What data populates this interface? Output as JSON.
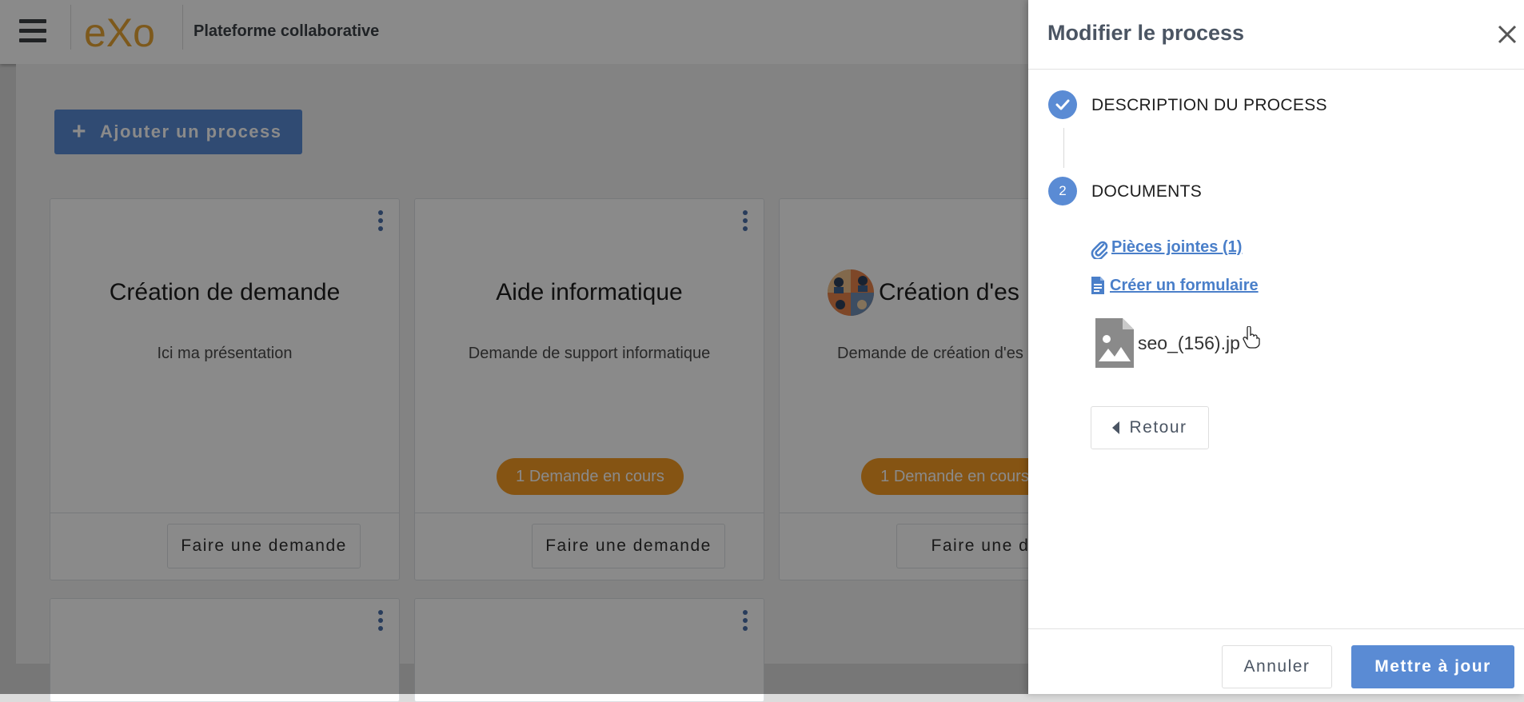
{
  "header": {
    "brand": "eXo",
    "platform_name": "Plateforme collaborative"
  },
  "toolbar": {
    "add_process_label": "Ajouter un process"
  },
  "cards": [
    {
      "title": "Création de demande",
      "description": "Ici ma présentation",
      "badge": "",
      "action": "Faire une demande"
    },
    {
      "title": "Aide informatique",
      "description": "Demande de support informatique",
      "badge": "1 Demande en cours",
      "action": "Faire une demande"
    },
    {
      "title": "Création d'es",
      "description": "Demande de création d'es",
      "badge": "1 Demande en cours",
      "action": "Faire une dem"
    }
  ],
  "drawer": {
    "title": "Modifier le process",
    "steps": [
      {
        "number": "",
        "label": "DESCRIPTION DU PROCESS",
        "status": "done"
      },
      {
        "number": "2",
        "label": "DOCUMENTS",
        "status": "active"
      }
    ],
    "attachments_link": "Pièces jointes (1)",
    "create_form_link": "Créer un formulaire",
    "file_name": "seo_(156).jp",
    "back_label": "Retour",
    "cancel_label": "Annuler",
    "update_label": "Mettre à jour"
  },
  "colors": {
    "primary": "#5a8bd4",
    "badge": "#f59b23",
    "link": "#4a7fc9"
  }
}
